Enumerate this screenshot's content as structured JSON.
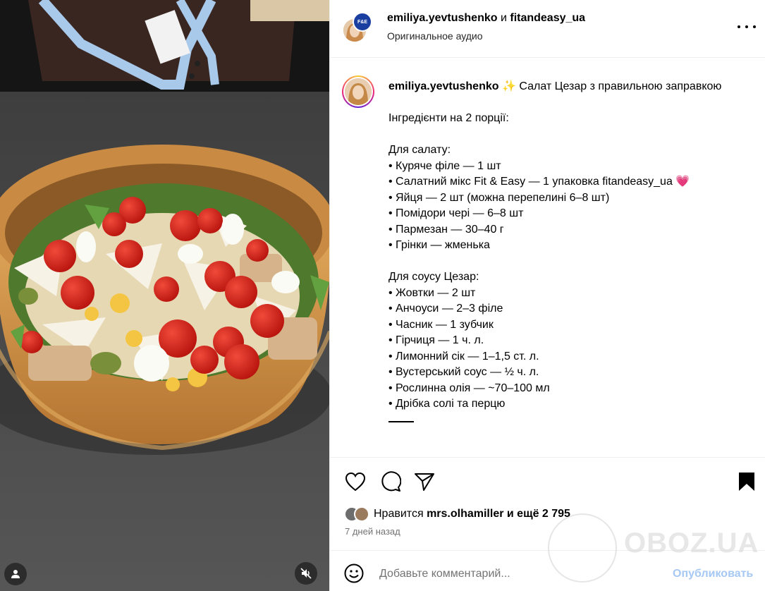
{
  "header": {
    "user1": "emiliya.yevtushenko",
    "joiner": "и",
    "user2": "fitandeasy_ua",
    "audio": "Оригинальное аудио",
    "badge_text": "F&E"
  },
  "caption": {
    "author": "emiliya.yevtushenko",
    "title": "Салат Цезар з правильною заправкою",
    "lines": [
      "Інгредієнти на 2 порції:",
      "",
      "Для салату:",
      "• Куряче філе — 1 шт",
      "• Салатний мікс Fit & Easy — 1 упаковка fitandeasy_ua",
      "• Яйця — 2 шт (можна перепелині 6–8 шт)",
      "• Помідори чері — 6–8 шт",
      "• Пармезан — 30–40 г",
      "• Грінки — жменька",
      "",
      "Для соусу Цезар:",
      "• Жовтки — 2 шт",
      "• Анчоуси — 2–3 філе",
      "• Часник — 1 зубчик",
      "• Гірчиця — 1 ч. л.",
      "• Лимонний сік — 1–1,5 ст. л.",
      "• Вустерський соус — ½ ч. л.",
      "• Рослинна олія — ~70–100 мл",
      "• Дрібка солі та перцю"
    ],
    "sparkle": "✨",
    "heart": "💗"
  },
  "likes": {
    "prefix": "Нравится",
    "user": "mrs.olhamiller",
    "suffix": "и ещё 2 795"
  },
  "time": "7 дней назад",
  "comment": {
    "placeholder": "Добавьте комментарий...",
    "publish": "Опубликовать"
  },
  "watermark": "OBOZ.UA",
  "colors": {
    "publish": "#a6c8f5",
    "secondary_text": "#737373",
    "divider": "#efefef",
    "story_ring": "#ee2a7b"
  }
}
